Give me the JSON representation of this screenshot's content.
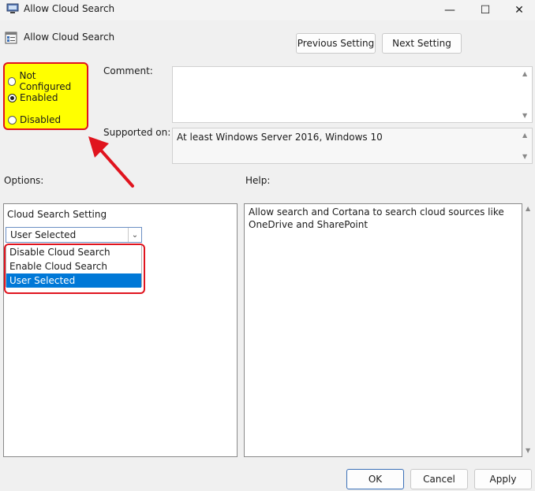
{
  "window": {
    "title": "Allow Cloud Search",
    "minimize_glyph": "—",
    "maximize_glyph": "☐",
    "close_glyph": "✕"
  },
  "policy": {
    "name": "Allow Cloud Search"
  },
  "nav": {
    "previous_label": "Previous Setting",
    "next_label": "Next Setting"
  },
  "state": {
    "options": [
      {
        "label": "Not Configured",
        "checked": false
      },
      {
        "label": "Enabled",
        "checked": true
      },
      {
        "label": "Disabled",
        "checked": false
      }
    ],
    "highlight_color": "#ffff00",
    "annotation_color": "#e0141e"
  },
  "comment": {
    "label": "Comment:",
    "value": ""
  },
  "supported": {
    "label": "Supported on:",
    "value": "At least Windows Server 2016, Windows 10"
  },
  "options": {
    "label": "Options:",
    "setting_label": "Cloud Search Setting",
    "selected": "User Selected",
    "list": [
      "Disable Cloud Search",
      "Enable Cloud Search",
      "User Selected"
    ]
  },
  "help": {
    "label": "Help:",
    "text": "Allow search and Cortana to search cloud sources like OneDrive and SharePoint"
  },
  "footer": {
    "ok_label": "OK",
    "cancel_label": "Cancel",
    "apply_label": "Apply"
  },
  "accent_color": "#0078d7"
}
